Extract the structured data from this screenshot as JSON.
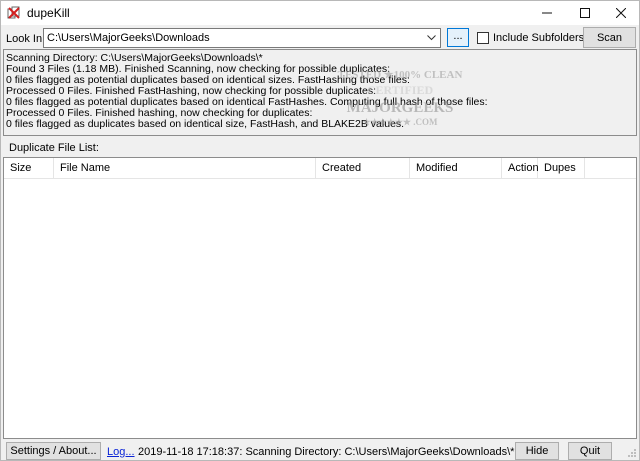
{
  "window": {
    "title": "dupeKill",
    "controls": {
      "minimize": "—",
      "maximize": "☐",
      "close": "✕"
    }
  },
  "toolbar": {
    "look_in_label": "Look In:",
    "path_value": "C:\\Users\\MajorGeeks\\Downloads",
    "browse_label": "...",
    "include_subfolders_label": "Include Subfolders",
    "include_subfolders_checked": false,
    "scan_label": "Scan"
  },
  "log": {
    "lines": [
      "Scanning Directory: C:\\Users\\MajorGeeks\\Downloads\\*",
      "Found 3 Files (1.18 MB). Finished Scanning, now checking for possible duplicates:",
      "0 files flagged as potential duplicates based on identical sizes. FastHashing those files:",
      "Processed 0 Files. Finished FastHashing, now checking for possible duplicates:",
      "0 files flagged as potential duplicates based on identical FastHashes. Computing full hash of those files:",
      "Processed 0 Files. Finished hashing, now checking for duplicates:",
      "0 files flagged as duplicates based on identical size, FastHash, and BLAKE2B values."
    ],
    "watermark": {
      "line1": "TESTED ★100% CLEAN",
      "line2": "CERTIFIED",
      "line3": "MAJORGEEKS",
      "line4": "★★★★★★ .COM"
    }
  },
  "duplicate_list": {
    "label": "Duplicate File List:",
    "columns": [
      "Size",
      "File Name",
      "Created",
      "Modified",
      "Action",
      "Dupes"
    ],
    "rows": []
  },
  "statusbar": {
    "settings_label": "Settings / About...",
    "log_link": "Log...",
    "status_text": "2019-11-18 17:18:37: Scanning Directory: C:\\Users\\MajorGeeks\\Downloads\\*",
    "hide_label": "Hide",
    "quit_label": "Quit"
  },
  "icons": {
    "app": "dupekill-app-icon",
    "combo": "chevron-down-icon",
    "grip": "resize-grip-icon"
  },
  "colors": {
    "accent_border": "#0078d7",
    "link": "#0b24d6"
  }
}
